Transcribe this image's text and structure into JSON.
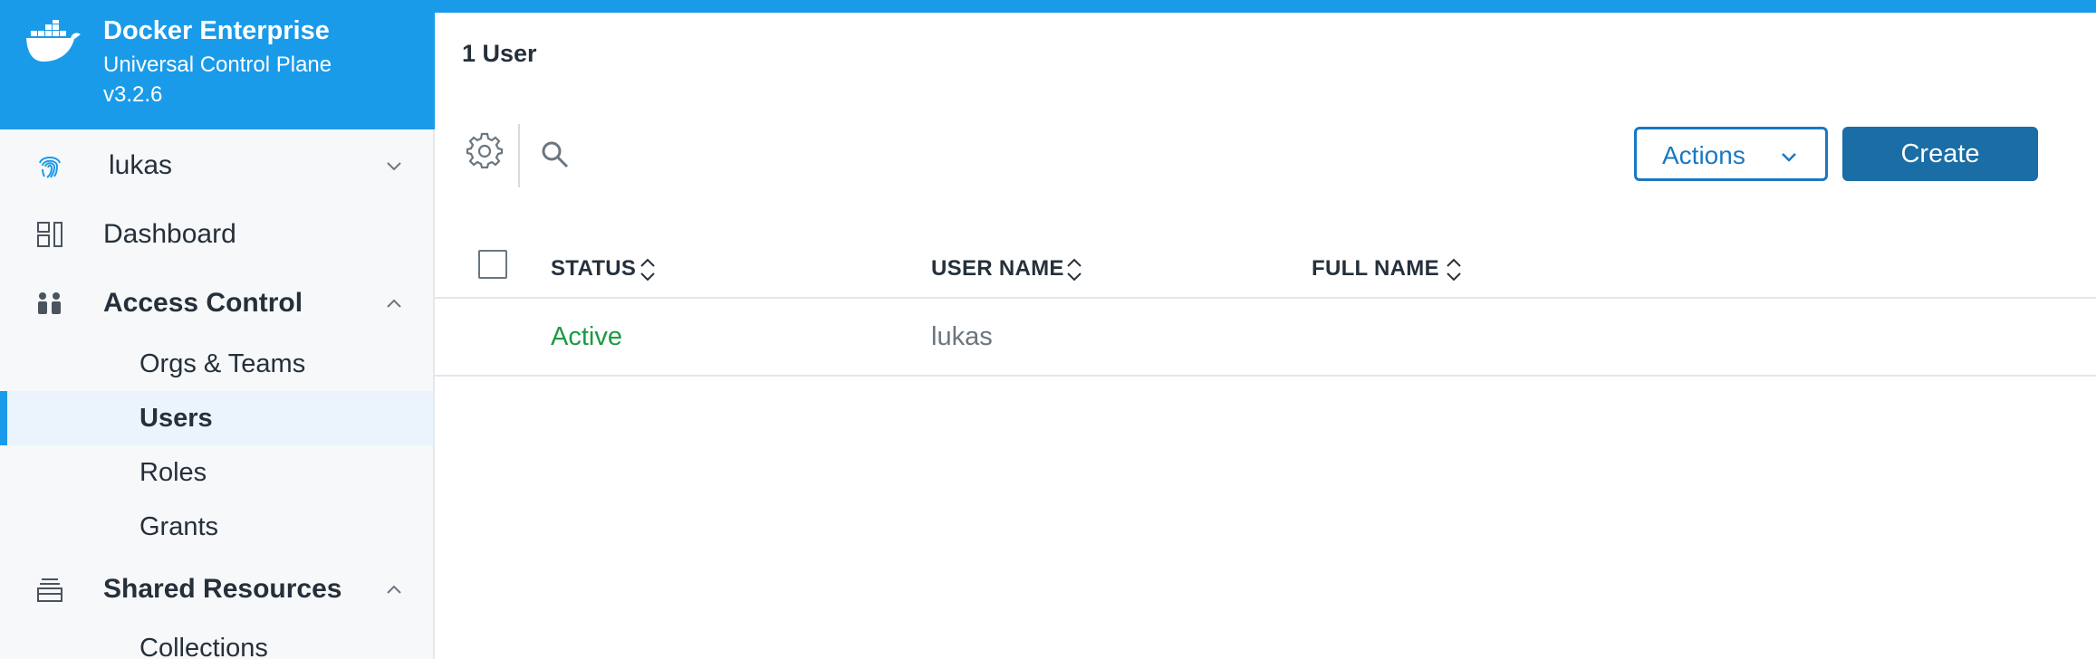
{
  "app": {
    "brand_title": "Docker Enterprise",
    "brand_subtitle": "Universal Control Plane",
    "version": "v3.2.6",
    "brand_color": "#1a9bea"
  },
  "sidebar": {
    "user": {
      "label": "lukas",
      "icon": "fingerprint-icon"
    },
    "items": [
      {
        "label": "Dashboard",
        "icon": "dashboard-icon"
      },
      {
        "label": "Access Control",
        "icon": "users-icon",
        "expanded": true,
        "children": [
          "Orgs & Teams",
          "Users",
          "Roles",
          "Grants"
        ],
        "active_child": "Users"
      },
      {
        "label": "Shared Resources",
        "icon": "stack-icon",
        "expanded": true,
        "children": [
          "Collections"
        ]
      }
    ]
  },
  "main": {
    "count_label": "1 User",
    "toolbar": {
      "actions_label": "Actions",
      "create_label": "Create"
    },
    "table": {
      "columns": [
        "STATUS",
        "USER NAME",
        "FULL NAME"
      ],
      "rows": [
        {
          "status": "Active",
          "user_name": "lukas",
          "full_name": ""
        }
      ]
    },
    "colors": {
      "status_active": "#1c9a44",
      "primary_button": "#1a6da5",
      "outline_button": "#1a78c2"
    }
  }
}
